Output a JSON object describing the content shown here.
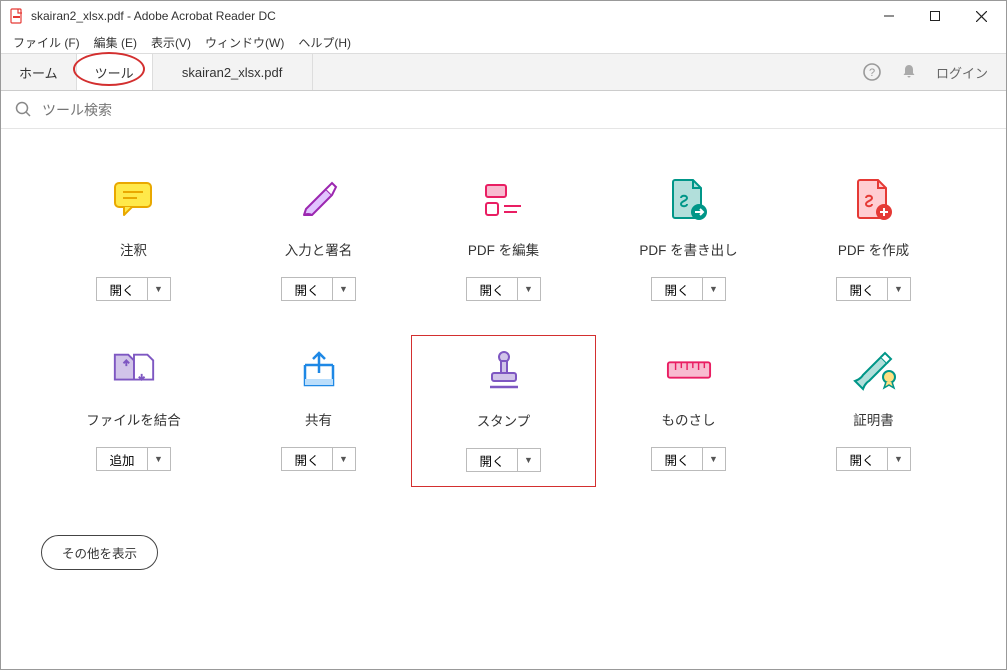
{
  "window": {
    "title": "skairan2_xlsx.pdf - Adobe Acrobat Reader DC"
  },
  "menu": {
    "file": "ファイル (F)",
    "edit": "編集 (E)",
    "view": "表示(V)",
    "window": "ウィンドウ(W)",
    "help": "ヘルプ(H)"
  },
  "tabs": {
    "home": "ホーム",
    "tools": "ツール",
    "doc": "skairan2_xlsx.pdf",
    "login": "ログイン"
  },
  "search": {
    "placeholder": "ツール検索"
  },
  "tools": [
    {
      "label": "注釈",
      "action": "開く"
    },
    {
      "label": "入力と署名",
      "action": "開く"
    },
    {
      "label": "PDF を編集",
      "action": "開く"
    },
    {
      "label": "PDF を書き出し",
      "action": "開く"
    },
    {
      "label": "PDF を作成",
      "action": "開く"
    },
    {
      "label": "ファイルを結合",
      "action": "追加"
    },
    {
      "label": "共有",
      "action": "開く"
    },
    {
      "label": "スタンプ",
      "action": "開く"
    },
    {
      "label": "ものさし",
      "action": "開く"
    },
    {
      "label": "証明書",
      "action": "開く"
    }
  ],
  "more_button": "その他を表示"
}
